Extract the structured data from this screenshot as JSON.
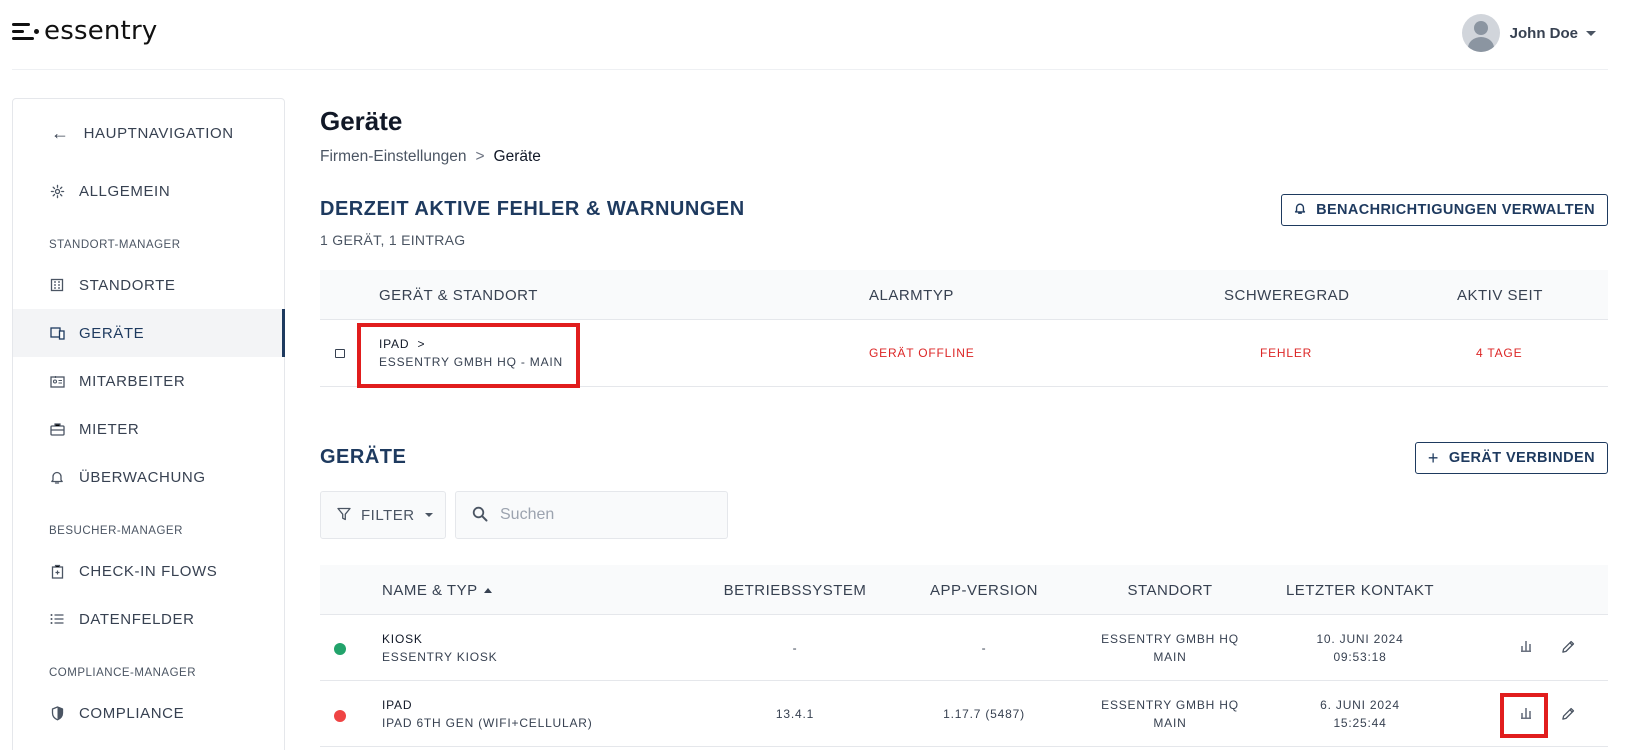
{
  "app": {
    "logo_text": "essentry"
  },
  "user": {
    "name": "John Doe"
  },
  "sidebar": {
    "back_label": "HAUPTNAVIGATION",
    "general_label": "ALLGEMEIN",
    "sections": {
      "standort": "STANDORT-MANAGER",
      "besucher": "BESUCHER-MANAGER",
      "compliance": "COMPLIANCE-MANAGER"
    },
    "items": {
      "standorte": "STANDORTE",
      "geraete": "GERÄTE",
      "mitarbeiter": "MITARBEITER",
      "mieter": "MIETER",
      "ueberwachung": "ÜBERWACHUNG",
      "checkin": "CHECK-IN FLOWS",
      "datenfelder": "DATENFELDER",
      "compliance": "COMPLIANCE"
    }
  },
  "page": {
    "title": "Geräte",
    "breadcrumb": {
      "parent": "Firmen-Einstellungen",
      "separator": ">",
      "current": "Geräte"
    }
  },
  "alerts": {
    "title": "DERZEIT AKTIVE FEHLER & WARNUNGEN",
    "subtitle": "1 GERÄT, 1 EINTRAG",
    "manage_button": "BENACHRICHTIGUNGEN VERWALTEN",
    "columns": {
      "device": "GERÄT & STANDORT",
      "alarm": "ALARMTYP",
      "severity": "SCHWEREGRAD",
      "active_since": "AKTIV SEIT"
    },
    "rows": [
      {
        "device": "IPAD",
        "chevron": ">",
        "location": "ESSENTRY GMBH HQ - MAIN",
        "alarm": "GERÄT OFFLINE",
        "severity": "FEHLER",
        "active_since": "4 TAGE"
      }
    ]
  },
  "devices": {
    "title": "GERÄTE",
    "connect_button": "GERÄT VERBINDEN",
    "filter_label": "FILTER",
    "search_placeholder": "Suchen",
    "columns": {
      "name": "NAME & TYP",
      "os": "BETRIEBSSYSTEM",
      "app": "APP-VERSION",
      "location": "STANDORT",
      "last_contact": "LETZTER KONTAKT"
    },
    "status_colors": {
      "online": "#22a36b",
      "offline": "#ef4444"
    },
    "rows": [
      {
        "name": "KIOSK",
        "type": "ESSENTRY KIOSK",
        "os": "-",
        "app": "-",
        "location_line1": "ESSENTRY GMBH HQ",
        "location_line2": "MAIN",
        "date": "10. JUNI 2024",
        "time": "09:53:18",
        "status": "online"
      },
      {
        "name": "IPAD",
        "type": "IPAD 6TH GEN (WIFI+CELLULAR)",
        "os": "13.4.1",
        "app": "1.17.7 (5487)",
        "location_line1": "ESSENTRY GMBH HQ",
        "location_line2": "MAIN",
        "date": "6. JUNI 2024",
        "time": "15:25:44",
        "status": "offline"
      }
    ]
  },
  "colors": {
    "accent": "#1e3a5f",
    "error": "#dc2626",
    "highlight": "#e11d1d"
  }
}
